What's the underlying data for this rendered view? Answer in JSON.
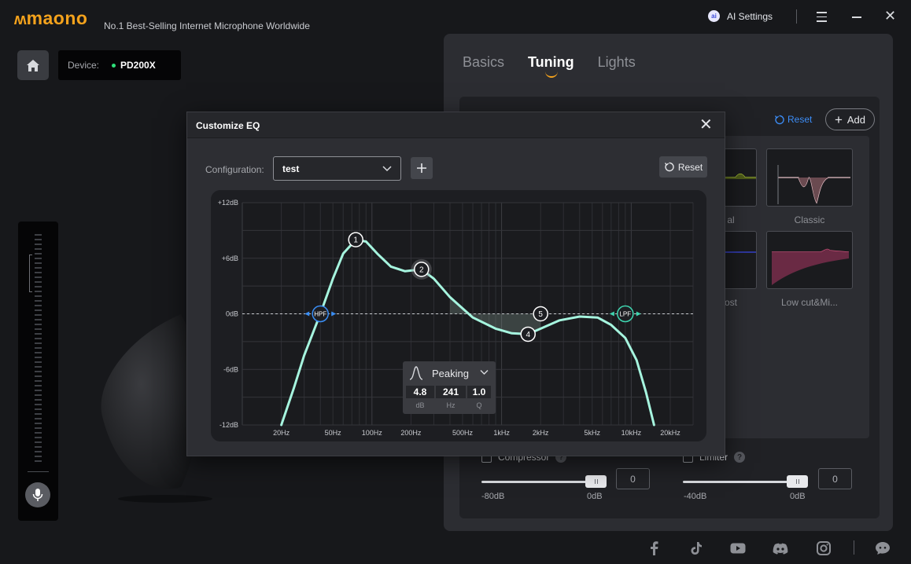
{
  "app": {
    "logo_mark": "ʍ",
    "logo_text": "maono",
    "tagline": "No.1 Best-Selling Internet Microphone Worldwide",
    "ai_settings_label": "AI Settings",
    "ai_icon_text": "ai"
  },
  "device": {
    "label": "Device:",
    "name": "PD200X",
    "status_color": "#2ee07a"
  },
  "tabs": [
    {
      "label": "Basics",
      "active": false
    },
    {
      "label": "Tuning",
      "active": true
    },
    {
      "label": "Lights",
      "active": false
    }
  ],
  "tuning": {
    "reset_label": "Reset",
    "add_label": "Add",
    "presets": [
      {
        "label": "al"
      },
      {
        "label": "Classic"
      },
      {
        "label": "ost"
      },
      {
        "label": "Low cut&Mi..."
      }
    ],
    "compressor": {
      "label": "Compressor",
      "value": "0",
      "min_label": "-80dB",
      "max_label": "0dB",
      "level": 1.0,
      "checked": false
    },
    "limiter": {
      "label": "Limiter",
      "value": "0",
      "min_label": "-40dB",
      "max_label": "0dB",
      "level": 1.0,
      "checked": false
    }
  },
  "dialog": {
    "title": "Customize EQ",
    "config_label": "Configuration:",
    "config_value": "test",
    "reset_label": "Reset",
    "popup": {
      "type": "Peaking",
      "gain": "4.8",
      "freq": "241",
      "q": "1.0",
      "gain_unit": "dB",
      "freq_unit": "Hz",
      "q_unit": "Q"
    }
  },
  "chart_data": {
    "type": "line",
    "y_ticks": [
      "+12dB",
      "+6dB",
      "0dB",
      "-6dB",
      "-12dB"
    ],
    "x_ticks": [
      "20Hz",
      "50Hz",
      "100Hz",
      "200Hz",
      "500Hz",
      "1kHz",
      "2kHz",
      "5kHz",
      "10kHz",
      "20kHz"
    ],
    "ylim": [
      -12,
      12
    ],
    "xlim": [
      10,
      30000
    ],
    "x_scale": "log",
    "bands": [
      {
        "label": "HPF",
        "freq": 40,
        "gain": 0
      },
      {
        "label": "1",
        "freq": 75,
        "gain": 8
      },
      {
        "label": "2",
        "freq": 241,
        "gain": 4.8
      },
      {
        "label": "4",
        "freq": 1600,
        "gain": -2.2
      },
      {
        "label": "5",
        "freq": 2000,
        "gain": 0
      },
      {
        "label": "LPF",
        "freq": 9000,
        "gain": 0
      }
    ],
    "curve": [
      [
        20,
        -12
      ],
      [
        25,
        -8
      ],
      [
        30,
        -4.5
      ],
      [
        40,
        0
      ],
      [
        50,
        3.8
      ],
      [
        60,
        6.5
      ],
      [
        75,
        8
      ],
      [
        90,
        7.8
      ],
      [
        110,
        6.5
      ],
      [
        140,
        5.1
      ],
      [
        180,
        4.6
      ],
      [
        241,
        4.8
      ],
      [
        300,
        3.8
      ],
      [
        400,
        1.8
      ],
      [
        600,
        -0.4
      ],
      [
        900,
        -1.6
      ],
      [
        1200,
        -2.1
      ],
      [
        1600,
        -2.2
      ],
      [
        2000,
        -1.6
      ],
      [
        2800,
        -0.7
      ],
      [
        4000,
        -0.3
      ],
      [
        5500,
        -0.4
      ],
      [
        7000,
        -1.2
      ],
      [
        9000,
        -2.6
      ],
      [
        11000,
        -5
      ],
      [
        13000,
        -8.5
      ],
      [
        15000,
        -12
      ]
    ],
    "curve_color": "#a6f5df",
    "hpf_color": "#3a8ef5",
    "lpf_color": "#3fd6b0"
  },
  "social": [
    "facebook",
    "tiktok",
    "youtube",
    "discord",
    "instagram",
    "chat"
  ]
}
